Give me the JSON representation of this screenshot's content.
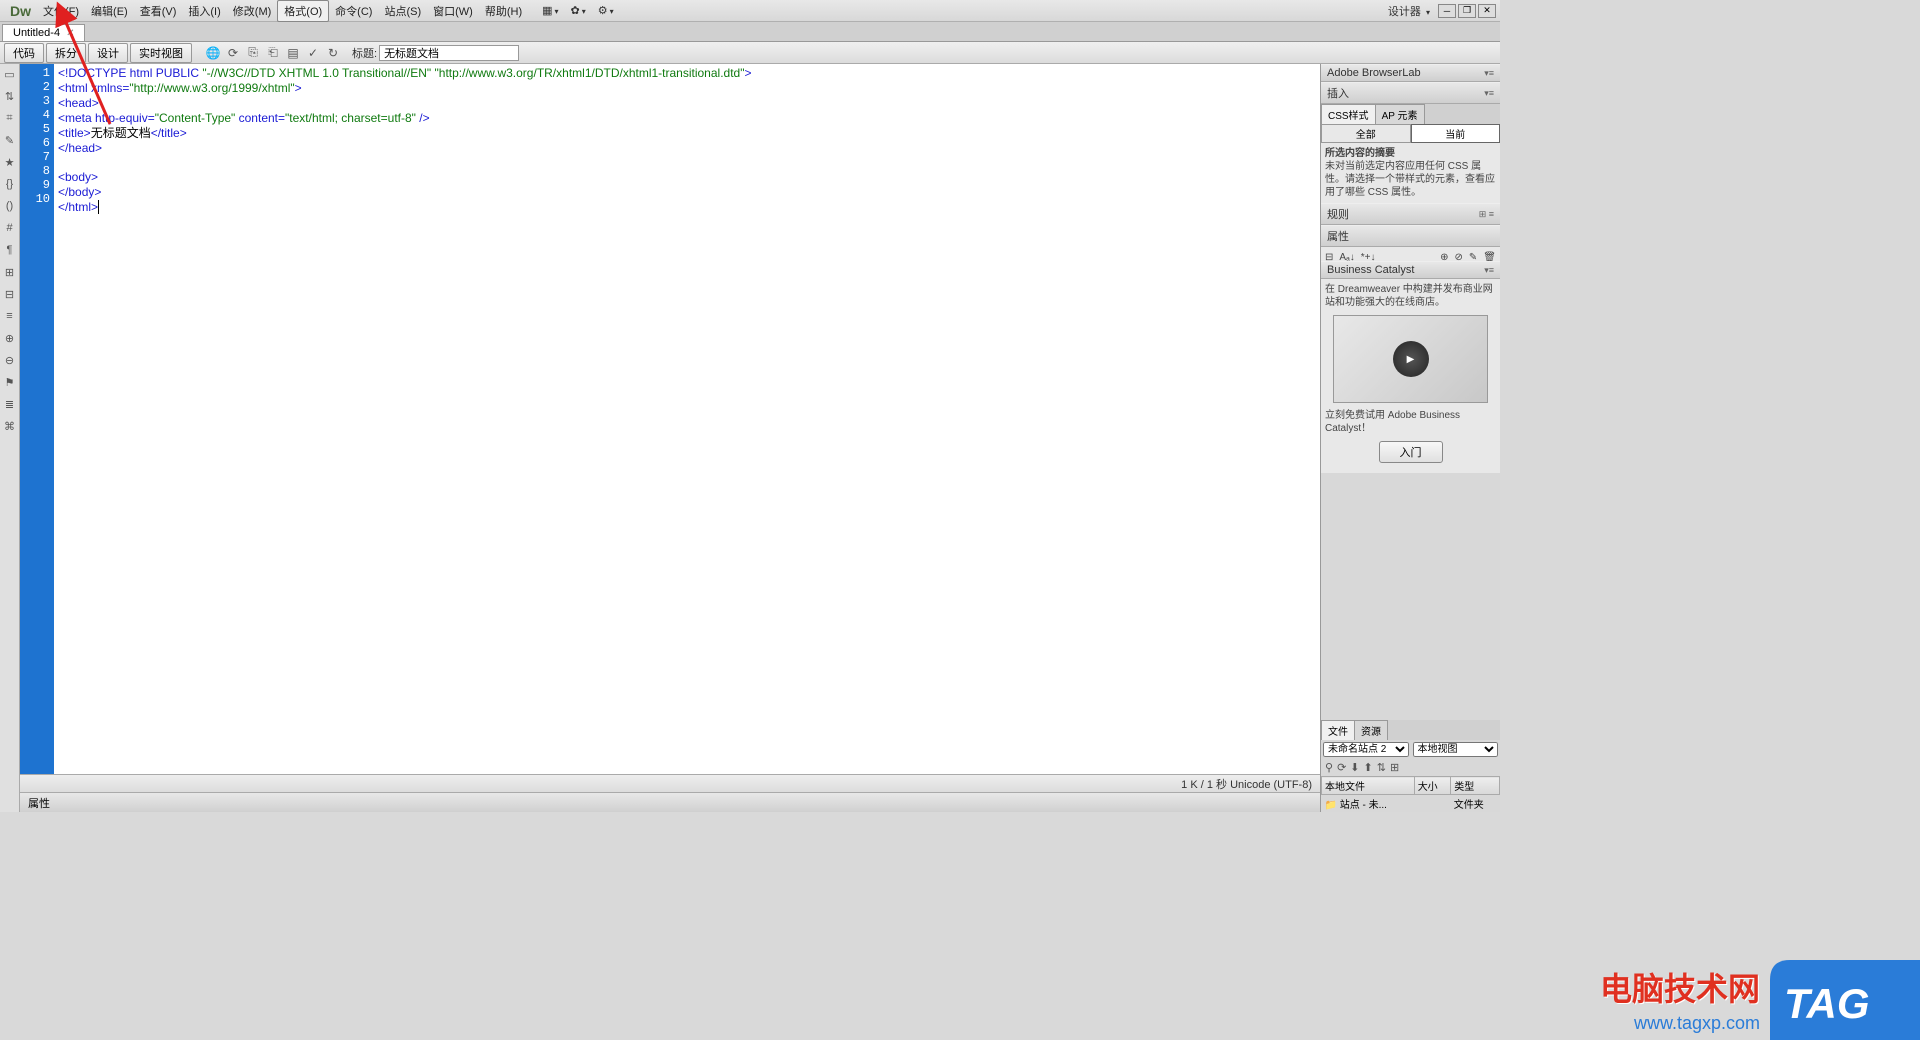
{
  "app": {
    "logo": "Dw"
  },
  "menu": {
    "items": [
      "文件(F)",
      "编辑(E)",
      "查看(V)",
      "插入(I)",
      "修改(M)",
      "格式(O)",
      "命令(C)",
      "站点(S)",
      "窗口(W)",
      "帮助(H)"
    ],
    "selected_index": 5,
    "workspace": "设计器"
  },
  "tab": {
    "name": "Untitled-4"
  },
  "toolbar": {
    "view_buttons": [
      "代码",
      "拆分",
      "设计",
      "实时视图"
    ],
    "title_label": "标题:",
    "title_value": "无标题文档"
  },
  "code": {
    "lines": [
      "<!DOCTYPE html PUBLIC \"-//W3C//DTD XHTML 1.0 Transitional//EN\" \"http://www.w3.org/TR/xhtml1/DTD/xhtml1-transitional.dtd\">",
      "<html xmlns=\"http://www.w3.org/1999/xhtml\">",
      "<head>",
      "<meta http-equiv=\"Content-Type\" content=\"text/html; charset=utf-8\" />",
      "<title>无标题文档</title>",
      "</head>",
      "",
      "<body>",
      "</body>",
      "</html>"
    ]
  },
  "status": {
    "text": "1 K / 1 秒 Unicode (UTF-8)"
  },
  "props": {
    "title": "属性"
  },
  "panels": {
    "browserlab": "Adobe BrowserLab",
    "insert": "插入",
    "css": {
      "tabs": [
        "CSS样式",
        "AP 元素"
      ],
      "buttons": [
        "全部",
        "当前"
      ],
      "summary_title": "所选内容的摘要",
      "summary_text": "未对当前选定内容应用任何 CSS 属性。请选择一个带样式的元素，查看应用了哪些 CSS 属性。",
      "rules": "规则",
      "properties": "属性"
    },
    "bc": {
      "title": "Business Catalyst",
      "text1": "在 Dreamweaver 中构建并发布商业网站和功能强大的在线商店。",
      "text2": "立刻免费试用 Adobe Business Catalyst！",
      "btn": "入门"
    },
    "files": {
      "tabs": [
        "文件",
        "资源"
      ],
      "site": "未命名站点 2",
      "view": "本地视图",
      "cols": [
        "本地文件",
        "大小",
        "类型"
      ],
      "row_name": "站点 - 未...",
      "row_type": "文件夹"
    }
  },
  "watermark": {
    "line1": "电脑技术网",
    "line2": "www.tagxp.com",
    "tag": "TAG"
  }
}
